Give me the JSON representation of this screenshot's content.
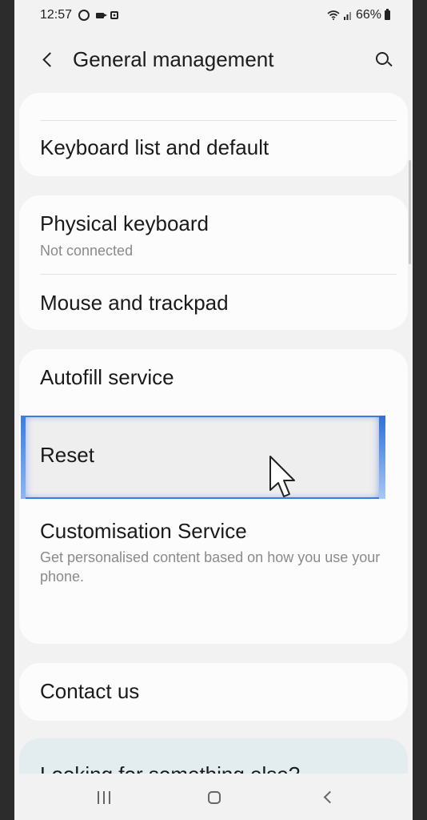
{
  "status_bar": {
    "time": "12:57",
    "battery": "66%"
  },
  "header": {
    "title": "General management"
  },
  "items": {
    "keyboard_list": {
      "title": "Keyboard list and default"
    },
    "physical_keyboard": {
      "title": "Physical keyboard",
      "subtitle": "Not connected"
    },
    "mouse_trackpad": {
      "title": "Mouse and trackpad"
    },
    "autofill": {
      "title": "Autofill service"
    },
    "reset": {
      "title": "Reset"
    },
    "customisation": {
      "title": "Customisation Service",
      "subtitle": "Get personalised content based on how you use your phone."
    },
    "contact": {
      "title": "Contact us"
    }
  },
  "suggestion": {
    "title": "Looking for something else?"
  },
  "colors": {
    "accent": "#3a7ce0",
    "background": "#f2f2f2",
    "card": "#fcfcfc"
  }
}
